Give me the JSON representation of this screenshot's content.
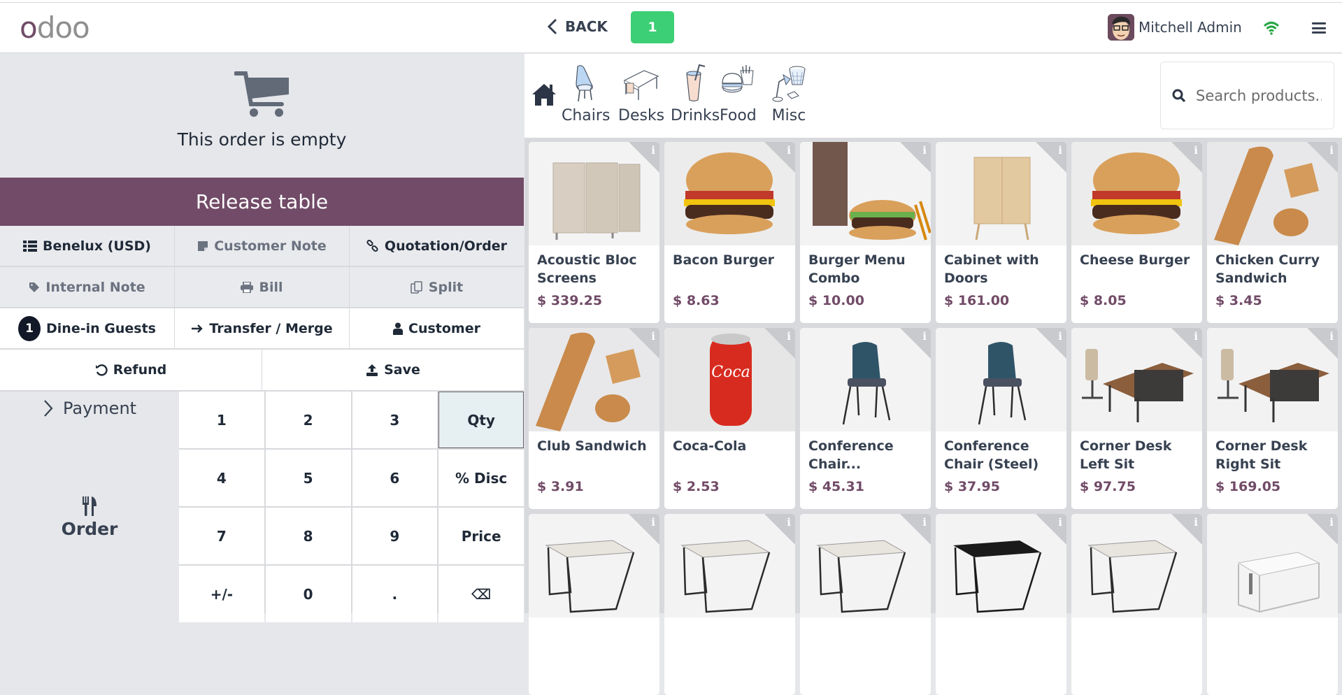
{
  "header": {
    "logo_first": "o",
    "logo_rest": "doo",
    "back_label": "BACK",
    "table_number": "1",
    "user_name": "Mitchell Admin",
    "icons": [
      "chevron-left-icon",
      "wifi-icon",
      "hamburger-menu-icon"
    ]
  },
  "order": {
    "empty_message": "This order is empty",
    "release_table_label": "Release table"
  },
  "controls": {
    "row1": [
      {
        "label": "Benelux (USD)",
        "icon": "list-icon"
      },
      {
        "label": "Customer Note",
        "icon": "sticky-note-icon"
      },
      {
        "label": "Quotation/Order",
        "icon": "link-icon"
      }
    ],
    "row2": [
      {
        "label": "Internal Note",
        "icon": "tag-icon"
      },
      {
        "label": "Bill",
        "icon": "printer-icon"
      },
      {
        "label": "Split",
        "icon": "copy-icon"
      }
    ],
    "row3": [
      {
        "label": "Dine-in Guests",
        "badge": "1"
      },
      {
        "label": "Transfer / Merge",
        "icon": "arrow-right-icon"
      },
      {
        "label": "Customer",
        "icon": "user-icon"
      }
    ],
    "row4": [
      {
        "label": "Refund",
        "icon": "undo-icon"
      },
      {
        "label": "Save",
        "icon": "upload-icon"
      }
    ]
  },
  "actions": {
    "payment_label": "Payment",
    "order_label": "Order"
  },
  "numpad": {
    "keys": [
      "1",
      "2",
      "3",
      "Qty",
      "4",
      "5",
      "6",
      "% Disc",
      "7",
      "8",
      "9",
      "Price",
      "+/-",
      "0",
      ".",
      "⌫"
    ],
    "active_mode": "Qty"
  },
  "categories": [
    {
      "label": "Chairs"
    },
    {
      "label": "Desks"
    },
    {
      "label": "Drinks"
    },
    {
      "label": "Food"
    },
    {
      "label": "Misc"
    }
  ],
  "search": {
    "placeholder": "Search products..."
  },
  "products": [
    {
      "name": "Acoustic Bloc Screens",
      "price": "$ 339.25",
      "img": "screen"
    },
    {
      "name": "Bacon Burger",
      "price": "$ 8.63",
      "img": "burger"
    },
    {
      "name": "Burger Menu Combo",
      "price": "$ 10.00",
      "img": "combo"
    },
    {
      "name": "Cabinet with Doors",
      "price": "$ 161.00",
      "img": "cabinet"
    },
    {
      "name": "Cheese Burger",
      "price": "$ 8.05",
      "img": "burger"
    },
    {
      "name": "Chicken Curry Sandwich",
      "price": "$ 3.45",
      "img": "sandwich"
    },
    {
      "name": "Club Sandwich",
      "price": "$ 3.91",
      "img": "sandwich"
    },
    {
      "name": "Coca-Cola",
      "price": "$ 2.53",
      "img": "can"
    },
    {
      "name": "Conference Chair...",
      "price": "$ 45.31",
      "img": "chair"
    },
    {
      "name": "Conference Chair (Steel)",
      "price": "$ 37.95",
      "img": "chair"
    },
    {
      "name": "Corner Desk Left Sit",
      "price": "$ 97.75",
      "img": "cornerdesk"
    },
    {
      "name": "Corner Desk Right Sit",
      "price": "$ 169.05",
      "img": "cornerdesk"
    },
    {
      "name": "",
      "price": "",
      "img": "table"
    },
    {
      "name": "",
      "price": "",
      "img": "table"
    },
    {
      "name": "",
      "price": "",
      "img": "table"
    },
    {
      "name": "",
      "price": "",
      "img": "table-black"
    },
    {
      "name": "",
      "price": "",
      "img": "table"
    },
    {
      "name": "",
      "price": "",
      "img": "desk-white"
    }
  ],
  "colors": {
    "brand": "#714b67",
    "table_badge": "#3ccf75",
    "wifi": "#28a745"
  }
}
